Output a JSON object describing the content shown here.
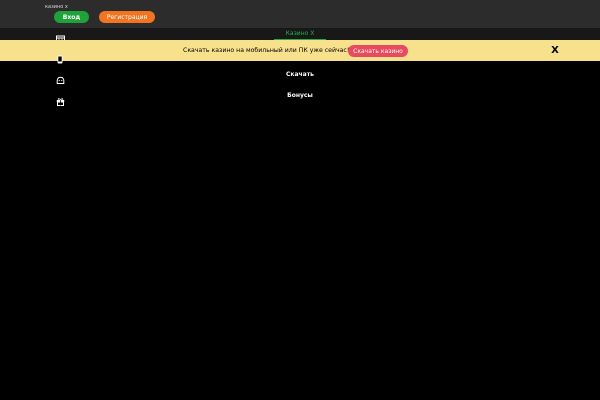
{
  "header": {
    "brand": "казино х",
    "login_label": "Вход",
    "register_label": "Регистрация"
  },
  "nav": {
    "active_tab": "Казино Х"
  },
  "banner": {
    "text": "Скачать казино на мобильный или ПК уже сейчас!",
    "button_label": "Скачать казино",
    "close_label": "X"
  },
  "menu": {
    "items": [
      {
        "label": "Скачать",
        "icon": "android-icon"
      },
      {
        "label": "Бонусы",
        "icon": "gift-icon"
      }
    ]
  },
  "colors": {
    "login": "#1fa23a",
    "register": "#f27420",
    "banner_bg": "#f7e18c",
    "banner_button": "#e84a5f",
    "active_tab": "#21b14a"
  }
}
